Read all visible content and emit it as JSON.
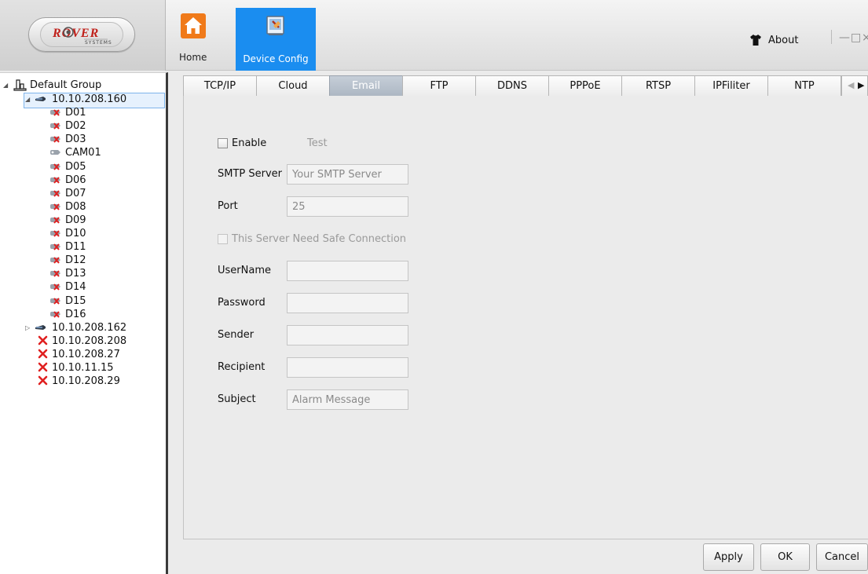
{
  "logo": {
    "text": "ROVER",
    "subtext": "SYSTEMS"
  },
  "nav": [
    {
      "label": "Home",
      "icon": "home-icon"
    },
    {
      "label": "Device Config",
      "icon": "device-config-icon"
    }
  ],
  "window": {
    "about_label": "About",
    "minimize_glyph": "—",
    "maximize_glyph": "□",
    "close_glyph": "×"
  },
  "tree": {
    "root": "Default Group",
    "devices": [
      {
        "label": "10.10.208.160",
        "expanded": true,
        "selected": true,
        "channels": [
          "D01",
          "D02",
          "D03",
          "CAM01",
          "D05",
          "D06",
          "D07",
          "D08",
          "D09",
          "D10",
          "D11",
          "D12",
          "D13",
          "D14",
          "D15",
          "D16"
        ]
      },
      {
        "label": "10.10.208.162",
        "expanded": false
      },
      {
        "label": "10.10.208.208",
        "offline": true
      },
      {
        "label": "10.10.208.27",
        "offline": true
      },
      {
        "label": "10.10.11.15",
        "offline": true
      },
      {
        "label": "10.10.208.29",
        "offline": true
      }
    ]
  },
  "tabs": [
    "TCP/IP",
    "Cloud",
    "Email",
    "FTP",
    "DDNS",
    "PPPoE",
    "RTSP",
    "IPFiliter",
    "NTP"
  ],
  "active_tab": "Email",
  "form": {
    "enable_label": "Enable",
    "test_label": "Test",
    "smtp_label": "SMTP Server",
    "smtp_placeholder": "Your SMTP Server",
    "port_label": "Port",
    "port_value": "25",
    "safe_conn_label": "This Server Need Safe Connection",
    "username_label": "UserName",
    "password_label": "Password",
    "sender_label": "Sender",
    "recipient_label": "Recipient",
    "subject_label": "Subject",
    "subject_value": "Alarm Message"
  },
  "buttons": {
    "apply": "Apply",
    "ok": "OK",
    "cancel": "Cancel"
  },
  "colors": {
    "accent": "#1a8df0",
    "offline": "#e02020",
    "tab_active": "#b7c0cb"
  }
}
